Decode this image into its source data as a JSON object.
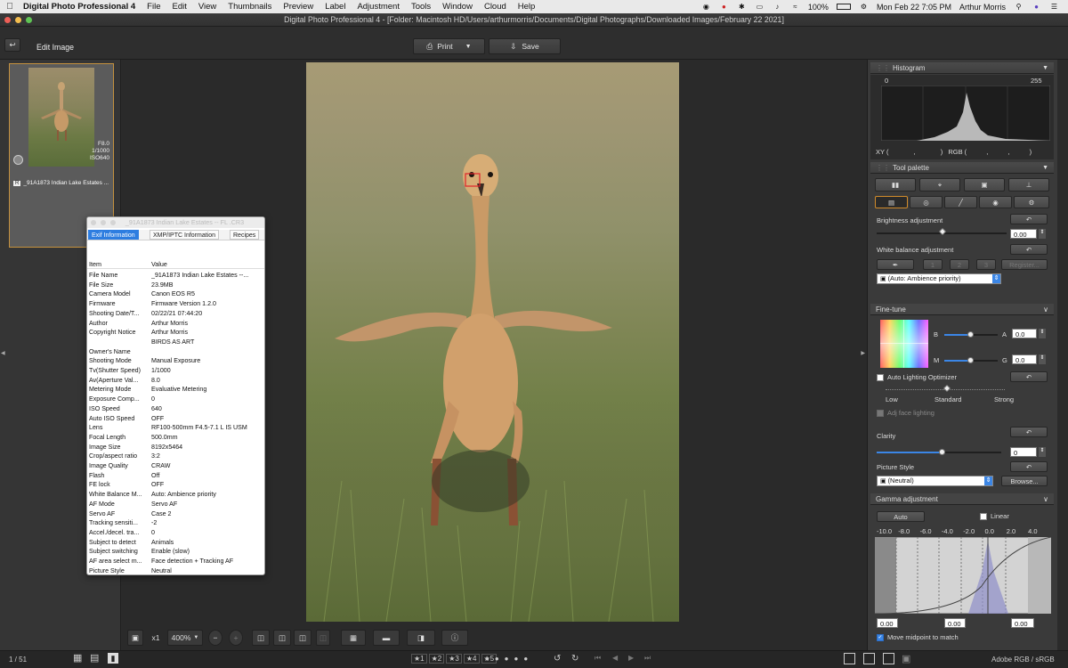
{
  "menubar": {
    "app": "Digital Photo Professional 4",
    "items": [
      "File",
      "Edit",
      "View",
      "Thumbnails",
      "Preview",
      "Label",
      "Adjustment",
      "Tools",
      "Window",
      "Cloud",
      "Help"
    ],
    "battery": "100%",
    "datetime": "Mon Feb 22  7:05 PM",
    "user": "Arthur Morris"
  },
  "window": {
    "title": "Digital Photo Professional 4 - [Folder: Macintosh HD/Users/arthurmorris/Documents/Digital Photographs/Downloaded Images/February 22 2021]"
  },
  "toolbar": {
    "edit_image": "Edit Image",
    "print": "Print",
    "save": "Save"
  },
  "thumbnail": {
    "aperture": "F8.0",
    "shutter": "1/1000",
    "iso": "ISO640",
    "badge": "R",
    "filename": "_91A1873  Indian Lake Estates ..."
  },
  "info": {
    "title": "_91A1873  Indian Lake Estates -- FL .CR3",
    "tabs": [
      "Exif Information",
      "XMP/IPTC Information",
      "Recipes"
    ],
    "col_item": "Item",
    "col_value": "Value",
    "rows": [
      [
        "File Name",
        "_91A1873  Indian Lake Estates --..."
      ],
      [
        "File Size",
        "23.9MB"
      ],
      [
        "Camera Model",
        "Canon EOS R5"
      ],
      [
        "Firmware",
        "Firmware Version 1.2.0"
      ],
      [
        "Shooting Date/T...",
        "02/22/21 07:44:20"
      ],
      [
        "Author",
        "Arthur Morris"
      ],
      [
        "Copyright Notice",
        "Arthur Morris"
      ],
      [
        "",
        "BIRDS AS ART"
      ],
      [
        "Owner's Name",
        ""
      ],
      [
        "Shooting Mode",
        "Manual Exposure"
      ],
      [
        "Tv(Shutter Speed)",
        "1/1000"
      ],
      [
        "Av(Aperture Val...",
        "8.0"
      ],
      [
        "Metering Mode",
        "Evaluative Metering"
      ],
      [
        "Exposure Comp...",
        "0"
      ],
      [
        "ISO Speed",
        "640"
      ],
      [
        "Auto ISO Speed",
        "OFF"
      ],
      [
        "Lens",
        "RF100-500mm F4.5-7.1 L IS USM"
      ],
      [
        "Focal Length",
        "500.0mm"
      ],
      [
        "Image Size",
        "8192x5464"
      ],
      [
        "Crop/aspect ratio",
        "3:2"
      ],
      [
        "Image Quality",
        "CRAW"
      ],
      [
        "Flash",
        "Off"
      ],
      [
        "FE lock",
        "OFF"
      ],
      [
        "White Balance M...",
        "Auto: Ambience priority"
      ],
      [
        "AF Mode",
        "Servo AF"
      ],
      [
        "Servo AF",
        "Case 2"
      ],
      [
        "Tracking sensiti...",
        "-2"
      ],
      [
        "Accel./decel. tra...",
        "0"
      ],
      [
        "Subject to detect",
        "Animals"
      ],
      [
        "Subject switching",
        "Enable (slow)"
      ],
      [
        "AF area select m...",
        "Face detection + Tracking AF"
      ],
      [
        "Picture Style",
        "Neutral"
      ]
    ]
  },
  "viewer_tools": {
    "scale": "x1",
    "zoom": "400%"
  },
  "status": {
    "counter": "1 / 51",
    "ratings": [
      "1",
      "2",
      "3",
      "4",
      "5"
    ],
    "colorspace": "Adobe RGB / sRGB"
  },
  "histogram": {
    "title": "Histogram",
    "min": "0",
    "max": "255",
    "xy_label": "XY (",
    "xy_sep": ",",
    "xy_close": ")",
    "rgb_label": "RGB (",
    "rgb_sep1": ",",
    "rgb_sep2": ",",
    "rgb_close": ")"
  },
  "tool_palette": {
    "title": "Tool palette",
    "brightness_label": "Brightness adjustment",
    "brightness_value": "0.00",
    "wb_label": "White balance adjustment",
    "wb_buttons": [
      "1",
      "2",
      "3"
    ],
    "register": "Register...",
    "wb_select": "(Auto: Ambience priority)",
    "fine_tune": "Fine-tune",
    "b_label": "B",
    "a_label": "A",
    "m_label": "M",
    "g_label": "G",
    "ba_value": "0.0",
    "mg_value": "0.0",
    "alo_label": "Auto Lighting Optimizer",
    "alo_low": "Low",
    "alo_standard": "Standard",
    "alo_strong": "Strong",
    "adj_face": "Adj face lighting",
    "clarity_label": "Clarity",
    "clarity_value": "0",
    "ps_label": "Picture Style",
    "ps_select": "(Neutral)",
    "browse": "Browse...",
    "gamma_title": "Gamma adjustment",
    "auto": "Auto",
    "linear": "Linear",
    "gamma_ticks": [
      "-10.0",
      "-8.0",
      "-6.0",
      "-4.0",
      "-2.0",
      "0.0",
      "2.0",
      "4.0"
    ],
    "gamma_values": [
      "0.00",
      "0.00",
      "0.00"
    ],
    "midpoint": "Move midpoint to match"
  }
}
